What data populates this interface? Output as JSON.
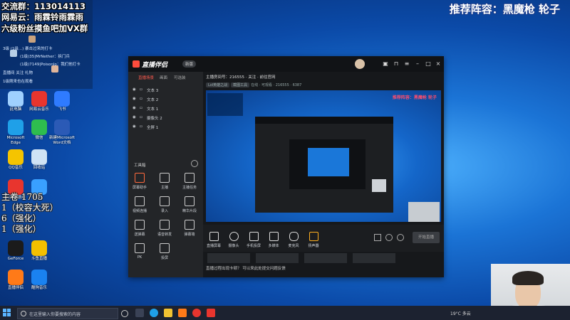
{
  "overlay": {
    "group_line": "交流群：113014113",
    "line2": "网易云：雨霖铃雨霖雨",
    "line3": "六级粉丝摸鱼吧加VX群",
    "chat": [
      "3级 (1级...) 暴击过来的打卡",
      "(1级)35|MrNether：拆门兵",
      "(1级)7149|Poisonlo：我们他打卡",
      "直播间 关注 礼物",
      "进入直播间 (小红)",
      "1级刚来也在观看"
    ]
  },
  "stream_title": "推荐阵容：黑魔枪 轮子",
  "side_text": [
    "主卷 1705",
    "1（校容大死）",
    "6（强化）",
    "1（强化）"
  ],
  "desktop_icons": [
    {
      "label": "此电脑",
      "color": "#9fd0ff"
    },
    {
      "label": "网易云音乐",
      "color": "#e8352e"
    },
    {
      "label": "飞书",
      "color": "#2f7bff"
    },
    {
      "label": "Microsoft Edge",
      "color": "#1fa0e8"
    },
    {
      "label": "微信",
      "color": "#2ebd4f"
    },
    {
      "label": "新建Microsoft Word文档",
      "color": "#2b5ab6"
    },
    {
      "label": "QQ音乐",
      "color": "#f5c400"
    },
    {
      "label": "回收站",
      "color": "#cfe3f5"
    },
    {
      "label": "网易云游戏",
      "color": "#e8352e"
    },
    {
      "label": "UU",
      "color": "#39a0ff"
    },
    {
      "label": "GeForce",
      "color": "#1b1b1b"
    },
    {
      "label": "斗鱼直播",
      "color": "#f3c000"
    },
    {
      "label": "直播伴侣",
      "color": "#ff7a18"
    },
    {
      "label": "酷狗音乐",
      "color": "#1a82f0"
    }
  ],
  "app": {
    "name": "直播伴侣",
    "version": "新版",
    "tabs": [
      "直播场景",
      "画面",
      "可选装"
    ],
    "scenes": [
      "文本 3",
      "文本 2",
      "文本 1",
      "摄像头 2",
      "全屏 1"
    ],
    "toolbox_label": "工具箱",
    "tools": [
      "屏幕助手",
      "主播",
      "主播任务",
      "视频连播",
      "录入",
      "精华片段",
      "送弹幕",
      "语音转发",
      "弹幕墙",
      "PK",
      "投屏"
    ],
    "room_info": "主播房间号：216555 · 关注 · 前往官网",
    "room_sub_tags": [
      "Lol英雄之战",
      "截图工具"
    ],
    "room_sub_text": "在线 · 可观看 · 216555 · 6387",
    "preview_caption": "推荐阵容：黑魔枪 轮子",
    "bottom_buttons": [
      "直播屏幕",
      "摄像头",
      "手机投屏",
      "多媒体",
      "麦克风",
      "扬声器"
    ],
    "start_live": "开始直播",
    "notice": "直播过程出现卡顿？ 可以来此处提交问题反馈"
  },
  "taskbar": {
    "search_placeholder": "在这里输入你要搜索的内容",
    "weather": "19°C 多云"
  }
}
